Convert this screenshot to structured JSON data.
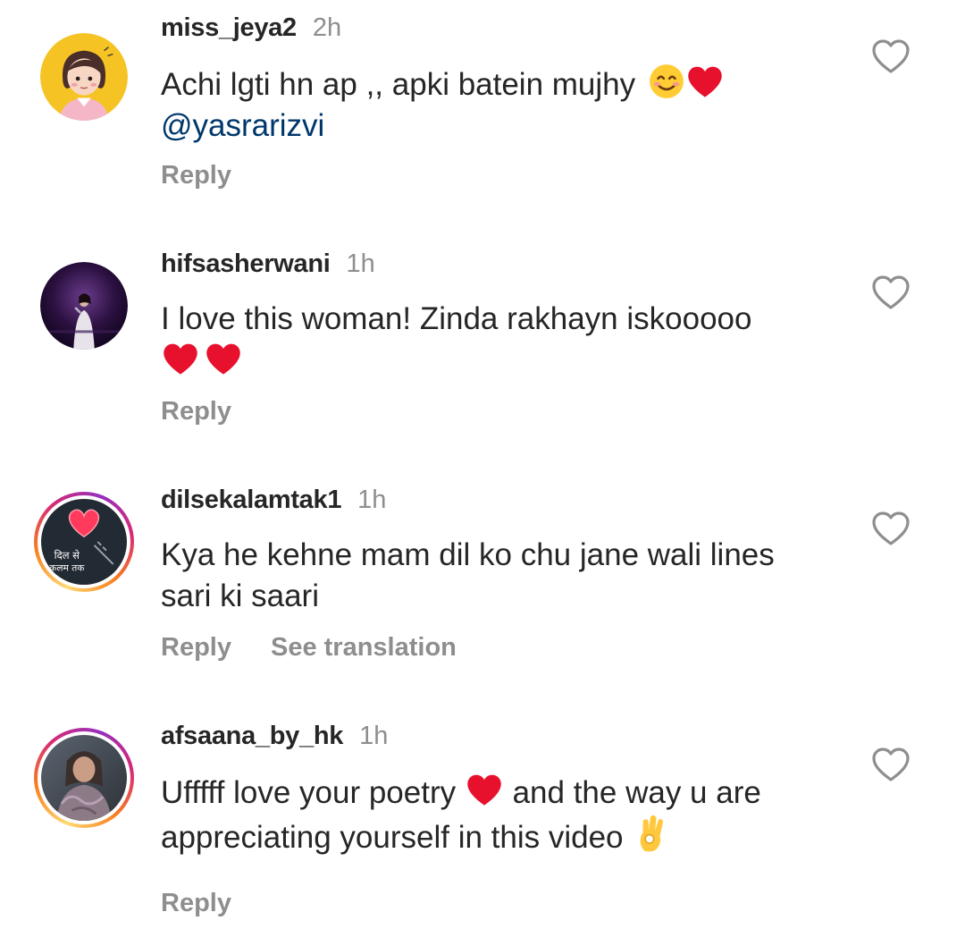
{
  "comments": [
    {
      "username": "miss_jeya2",
      "time": "2h",
      "text_line1": "Achi lgti hn ap ,, apki batein mujhy",
      "mention": "@yasrarizvi",
      "emojis": [
        "smiling-face-emoji",
        "red-heart-emoji"
      ],
      "reply": "Reply"
    },
    {
      "username": "hifsasherwani",
      "time": "1h",
      "text_line1": "I love this woman! Zinda rakhayn iskooooo",
      "emojis": [
        "red-heart-emoji",
        "red-heart-emoji"
      ],
      "reply": "Reply"
    },
    {
      "username": "dilsekalamtak1",
      "time": "1h",
      "text_line1": "Kya he kehne mam dil ko chu jane wali lines",
      "text_line2": "sari ki saari",
      "reply": "Reply",
      "see_translation": "See translation",
      "avatar_text_line1": "दिल से",
      "avatar_text_line2": "कलम तक"
    },
    {
      "username": "afsaana_by_hk",
      "time": "1h",
      "text_line1_a": "Ufffff love your poetry",
      "text_line1_b": "and the way u are",
      "text_line2": "appreciating yourself in this video",
      "emojis": [
        "red-heart-emoji",
        "ok-hand-emoji"
      ],
      "reply": "Reply"
    }
  ],
  "icons": {
    "like": "heart-outline-icon"
  },
  "colors": {
    "text_primary": "#262626",
    "text_secondary": "#8e8e8e",
    "mention": "#00376b",
    "heart_red": "#e0245e",
    "background": "#ffffff"
  }
}
